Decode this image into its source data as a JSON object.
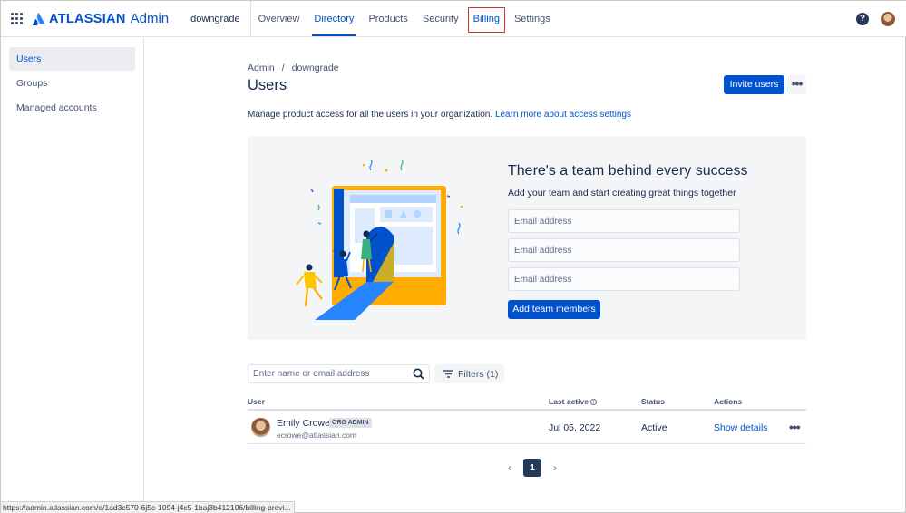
{
  "topbar": {
    "logo_text": "ATLASSIAN",
    "product_name": "Admin",
    "org_name": "downgrade",
    "nav": [
      {
        "label": "Overview"
      },
      {
        "label": "Directory"
      },
      {
        "label": "Products"
      },
      {
        "label": "Security"
      },
      {
        "label": "Billing"
      },
      {
        "label": "Settings"
      }
    ],
    "help_glyph": "?"
  },
  "sidebar": {
    "items": [
      {
        "label": "Users"
      },
      {
        "label": "Groups"
      },
      {
        "label": "Managed accounts"
      }
    ]
  },
  "breadcrumb": {
    "root": "Admin",
    "separator": "/",
    "current": "downgrade"
  },
  "page": {
    "title": "Users",
    "invite_label": "Invite users",
    "more_glyph": "•••",
    "description": "Manage product access for all the users in your organization.",
    "learn_more": "Learn more about access settings"
  },
  "promo": {
    "title": "There's a team behind every success",
    "subtitle": "Add your team and start creating great things together",
    "email_placeholder": "Email address",
    "add_button": "Add team members"
  },
  "search": {
    "placeholder": "Enter name or email address"
  },
  "filters": {
    "label": "Filters (1)"
  },
  "table": {
    "headers": {
      "user": "User",
      "last_active": "Last active",
      "status": "Status",
      "actions": "Actions"
    },
    "rows": [
      {
        "name": "Emily Crowe",
        "badge": "ORG ADMIN",
        "email": "ecrowe@atlassian.com",
        "last_active": "Jul 05, 2022",
        "status": "Active",
        "action": "Show details",
        "more_glyph": "•••"
      }
    ]
  },
  "pagination": {
    "prev": "‹",
    "current": "1",
    "next": "›"
  },
  "status_bar": {
    "url": "https://admin.atlassian.com/o/1ad3c570-6j5c-1094-j4c5-1baj3b412106/billing-previ..."
  },
  "colors": {
    "brand": "#0052CC",
    "text": "#172B4D",
    "subtle": "#42526E",
    "promo_bg": "#F4F5F7",
    "highlight_border": "#d0302f"
  }
}
